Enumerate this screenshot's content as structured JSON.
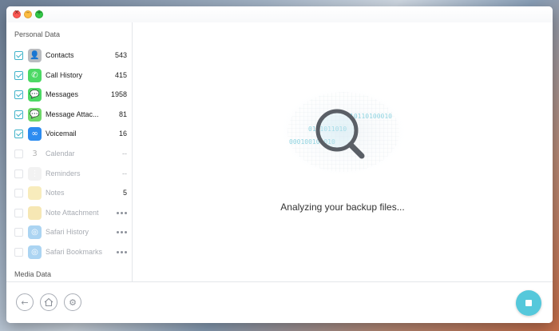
{
  "sidebar": {
    "personal_title": "Personal Data",
    "media_title": "Media Data",
    "items": [
      {
        "label": "Contacts",
        "count": "543",
        "checked": true,
        "enabled": true,
        "icon": "contacts-icon",
        "icon_color": "#b9bcc0"
      },
      {
        "label": "Call History",
        "count": "415",
        "checked": true,
        "enabled": true,
        "icon": "phone-icon",
        "icon_color": "#4cd964"
      },
      {
        "label": "Messages",
        "count": "1958",
        "checked": true,
        "enabled": true,
        "icon": "message-bubble-icon",
        "icon_color": "#4cd964"
      },
      {
        "label": "Message Attac...",
        "count": "81",
        "checked": true,
        "enabled": true,
        "icon": "attachment-icon",
        "icon_color": "#6fd86a"
      },
      {
        "label": "Voicemail",
        "count": "16",
        "checked": true,
        "enabled": true,
        "icon": "voicemail-icon",
        "icon_color": "#2d8cf0"
      },
      {
        "label": "Calendar",
        "count": "--",
        "checked": false,
        "enabled": false,
        "icon": "calendar-icon",
        "icon_color": "#e6e6e6",
        "icon_text": "3"
      },
      {
        "label": "Reminders",
        "count": "--",
        "checked": false,
        "enabled": false,
        "icon": "reminders-icon",
        "icon_color": "#eeeeee"
      },
      {
        "label": "Notes",
        "count": "5",
        "checked": false,
        "enabled": false,
        "icon": "notes-icon",
        "icon_color": "#f6e6a6"
      },
      {
        "label": "Note Attachment",
        "count": "",
        "checked": false,
        "enabled": false,
        "icon": "note-attachment-icon",
        "icon_color": "#f3df9b",
        "loading": true
      },
      {
        "label": "Safari History",
        "count": "",
        "checked": false,
        "enabled": false,
        "icon": "safari-icon",
        "icon_color": "#8fc6ee",
        "loading": true
      },
      {
        "label": "Safari Bookmarks",
        "count": "",
        "checked": false,
        "enabled": false,
        "icon": "safari-bookmark-icon",
        "icon_color": "#8fc6ee",
        "loading": true
      }
    ]
  },
  "main": {
    "status_text": "Analyzing your backup files...",
    "binary_lines": [
      "0101011010",
      "10110100010",
      "000100101010"
    ],
    "accent_color": "#55c8db"
  },
  "footer": {
    "back_icon": "back-arrow-icon",
    "home_icon": "home-icon",
    "settings_icon": "gear-icon",
    "stop_icon": "stop-icon"
  }
}
